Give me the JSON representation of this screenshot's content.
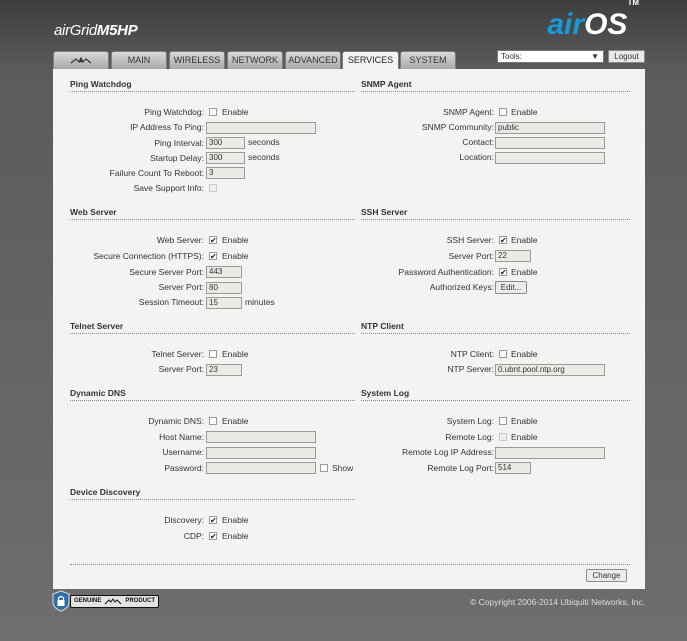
{
  "header": {
    "brand_prefix": "air",
    "brand_grid": "Grid",
    "brand_model": "M5HP",
    "os_logo_air": "air",
    "os_logo_os": "OS",
    "os_logo_tm": "TM"
  },
  "tabs": [
    {
      "label": "MAIN"
    },
    {
      "label": "WIRELESS"
    },
    {
      "label": "NETWORK"
    },
    {
      "label": "ADVANCED"
    },
    {
      "label": "SERVICES",
      "active": true
    },
    {
      "label": "SYSTEM"
    }
  ],
  "toolbar": {
    "tools_label": "Tools:",
    "logout_label": "Logout"
  },
  "ping_watchdog": {
    "title": "Ping Watchdog",
    "enable_label": "Ping Watchdog:",
    "enable_text": "Enable",
    "ip_label": "IP Address To Ping:",
    "ip_value": "",
    "interval_label": "Ping Interval:",
    "interval_value": "300",
    "interval_unit": "seconds",
    "delay_label": "Startup Delay:",
    "delay_value": "300",
    "delay_unit": "seconds",
    "failure_label": "Failure Count To Reboot:",
    "failure_value": "3",
    "support_label": "Save Support Info:"
  },
  "snmp": {
    "title": "SNMP Agent",
    "agent_label": "SNMP Agent:",
    "enable_text": "Enable",
    "community_label": "SNMP Community:",
    "community_value": "public",
    "contact_label": "Contact:",
    "contact_value": "",
    "location_label": "Location:",
    "location_value": ""
  },
  "web_server": {
    "title": "Web Server",
    "server_label": "Web Server:",
    "enable_text": "Enable",
    "secure_label": "Secure Connection (HTTPS):",
    "secure_port_label": "Secure Server Port:",
    "secure_port_value": "443",
    "port_label": "Server Port:",
    "port_value": "80",
    "timeout_label": "Session Timeout:",
    "timeout_value": "15",
    "timeout_unit": "minutes"
  },
  "ssh": {
    "title": "SSH Server",
    "server_label": "SSH Server:",
    "enable_text": "Enable",
    "port_label": "Server Port:",
    "port_value": "22",
    "password_auth_label": "Password Authentication:",
    "keys_label": "Authorized Keys:",
    "edit_label": "Edit..."
  },
  "telnet": {
    "title": "Telnet Server",
    "server_label": "Telnet Server:",
    "enable_text": "Enable",
    "port_label": "Server Port:",
    "port_value": "23"
  },
  "ntp": {
    "title": "NTP Client",
    "client_label": "NTP Client:",
    "enable_text": "Enable",
    "server_label": "NTP Server:",
    "server_value": "0.ubnt.pool.ntp.org"
  },
  "ddns": {
    "title": "Dynamic DNS",
    "ddns_label": "Dynamic DNS:",
    "enable_text": "Enable",
    "host_label": "Host Name:",
    "user_label": "Username:",
    "pass_label": "Password:",
    "show_label": "Show"
  },
  "syslog": {
    "title": "System Log",
    "log_label": "System Log:",
    "enable_text": "Enable",
    "remote_label": "Remote Log:",
    "remote_ip_label": "Remote Log IP Address:",
    "remote_ip_value": "",
    "remote_port_label": "Remote Log Port:",
    "remote_port_value": "514"
  },
  "discovery": {
    "title": "Device Discovery",
    "discovery_label": "Discovery:",
    "cdp_label": "CDP:",
    "enable_text": "Enable"
  },
  "footer": {
    "change_label": "Change",
    "genuine_text": "GENUINE",
    "product_text": "PRODUCT",
    "copyright": "© Copyright 2006-2014 Ubiquiti Networks, Inc."
  }
}
